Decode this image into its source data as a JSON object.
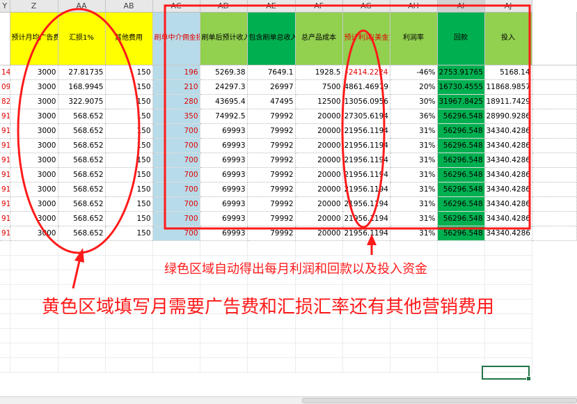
{
  "columns": [
    "Y",
    "Z",
    "AA",
    "AB",
    "AC",
    "AD",
    "AE",
    "AF",
    "AG",
    "AH",
    "AI",
    "AJ"
  ],
  "header_row": [
    "",
    "预计月均广告费",
    "汇损1%",
    "其他费用",
    "刷单中介佣金损失",
    "刷单后预计收入",
    "包含刷单总收入",
    "总产品成本",
    "预计利润(美金)",
    "利润率",
    "回款",
    "投入"
  ],
  "rows": [
    [
      "14",
      "3000",
      "27.81735",
      "150",
      "196",
      "5269.38",
      "7649.1",
      "1928.5",
      "-2414.2224",
      "-46%",
      "2753.91765",
      "5168.14"
    ],
    [
      "09",
      "3000",
      "168.9945",
      "150",
      "210",
      "24297.3",
      "26997",
      "7500",
      "4861.46979",
      "20%",
      "16730.4555",
      "11868.9857"
    ],
    [
      "82",
      "3000",
      "322.9075",
      "150",
      "280",
      "43695.4",
      "47495",
      "12500",
      "13056.0956",
      "30%",
      "31967.8425",
      "18911.7429"
    ],
    [
      "91",
      "3000",
      "568.652",
      "150",
      "350",
      "74992.5",
      "79992",
      "20000",
      "27305.6194",
      "36%",
      "56296.548",
      "28990.9286"
    ],
    [
      "91",
      "3000",
      "568.652",
      "150",
      "700",
      "69993",
      "79992",
      "20000",
      "21956.1194",
      "31%",
      "56296.548",
      "34340.4286"
    ],
    [
      "91",
      "3000",
      "568.652",
      "150",
      "700",
      "69993",
      "79992",
      "20000",
      "21956.1194",
      "31%",
      "56296.548",
      "34340.4286"
    ],
    [
      "91",
      "3000",
      "568.652",
      "150",
      "700",
      "69993",
      "79992",
      "20000",
      "21956.1194",
      "31%",
      "56296.548",
      "34340.4286"
    ],
    [
      "91",
      "3000",
      "568.652",
      "150",
      "700",
      "69993",
      "79992",
      "20000",
      "21956.1194",
      "31%",
      "56296.548",
      "34340.4286"
    ],
    [
      "91",
      "3000",
      "568.652",
      "150",
      "700",
      "69993",
      "79992",
      "20000",
      "21956.1194",
      "31%",
      "56296.548",
      "34340.4286"
    ],
    [
      "91",
      "3000",
      "568.652",
      "150",
      "700",
      "69993",
      "79992",
      "20000",
      "21956.1194",
      "31%",
      "56296.548",
      "34340.4286"
    ],
    [
      "91",
      "3000",
      "568.652",
      "150",
      "700",
      "69993",
      "79992",
      "20000",
      "21956.1194",
      "31%",
      "56296.548",
      "34340.4286"
    ],
    [
      "91",
      "3000",
      "568.652",
      "150",
      "700",
      "69993",
      "79992",
      "20000",
      "21956.1194",
      "31%",
      "56296.548",
      "34340.4286"
    ]
  ],
  "annotations": {
    "green_note": "绿色区域自动得出每月利润和回款以及投入资金",
    "yellow_note": "黄色区域填写月需要广告费和汇损汇率还有其他营销费用"
  },
  "colors": {
    "yellow": "#ffff00",
    "light_blue": "#b7dbe9",
    "light_green": "#92d050",
    "green": "#00b050",
    "annotation_red": "#ff1a1a"
  }
}
